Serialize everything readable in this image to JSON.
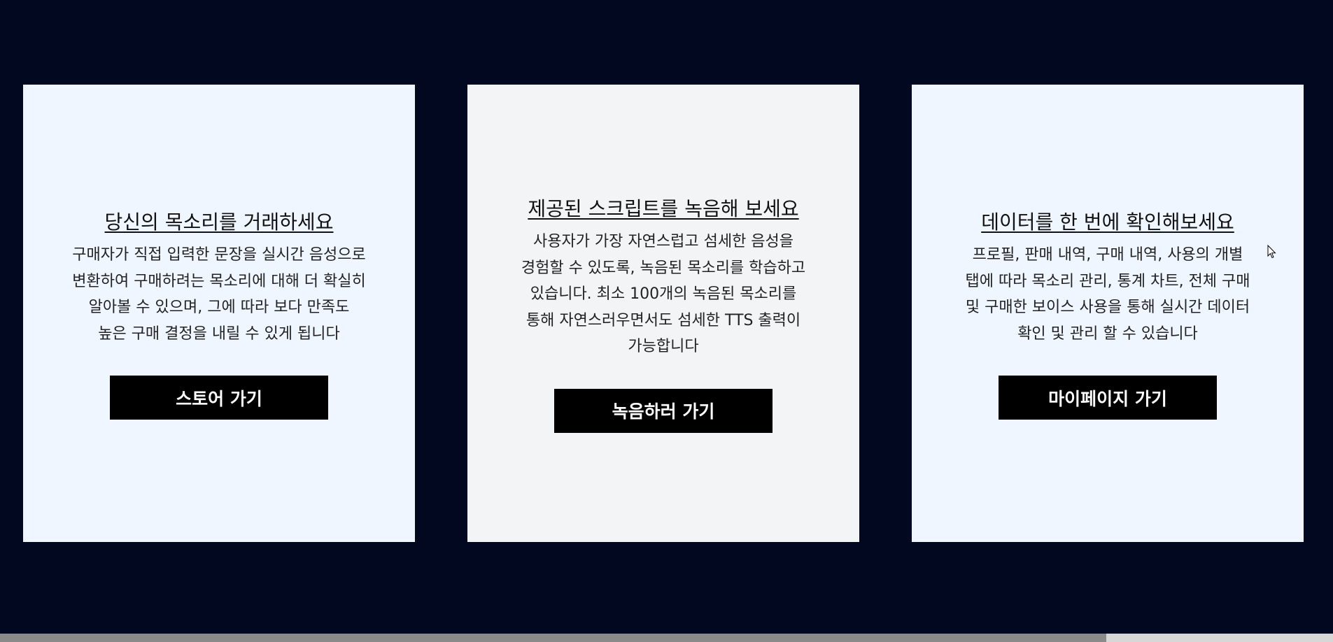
{
  "colors": {
    "page_background": "#020820",
    "card_1_background": "#EFF6FF",
    "card_2_background": "#F3F4F6",
    "card_3_background": "#EFF6FF",
    "button_background": "#000000",
    "button_text": "#FFFFFF"
  },
  "cards": [
    {
      "title": "당신의 목소리를 거래하세요",
      "description": "구매자가 직접 입력한 문장을 실시간 음성으로 변환하여 구매하려는 목소리에 대해 더 확실히 알아볼 수 있으며, 그에 따라 보다 만족도 높은 구매 결정을 내릴 수 있게 됩니다",
      "button_label": "스토어 가기"
    },
    {
      "title": "제공된 스크립트를 녹음해 보세요",
      "description": "사용자가 가장 자연스럽고 섬세한 음성을 경험할 수 있도록, 녹음된 목소리를 학습하고 있습니다. 최소 100개의 녹음된 목소리를 통해 자연스러우면서도 섬세한 TTS 출력이 가능합니다",
      "button_label": "녹음하러 가기"
    },
    {
      "title": "데이터를 한 번에 확인해보세요",
      "description": "프로필, 판매 내역, 구매 내역, 사용의 개별 탭에 따라 목소리 관리, 통계 차트, 전체 구매 및 구매한 보이스 사용을 통해 실시간 데이터 확인 및 관리 할 수 있습니다",
      "button_label": "마이페이지 가기"
    }
  ],
  "icons": {
    "cursor": "mouse-pointer-icon"
  },
  "scrollbar": {
    "horizontal_thumb_fraction": 0.83
  }
}
